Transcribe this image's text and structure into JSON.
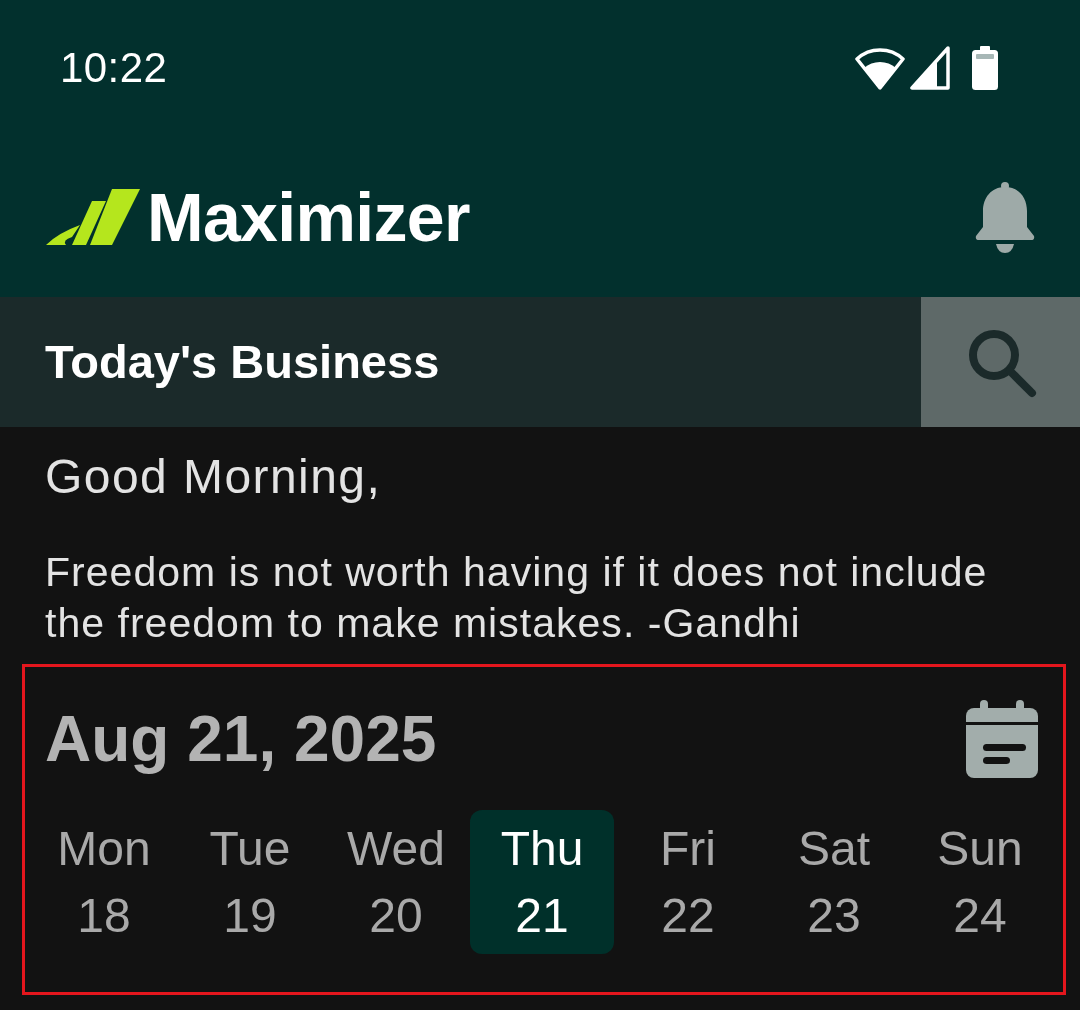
{
  "status_bar": {
    "time": "10:22"
  },
  "app_bar": {
    "logo_text": "Maximizer"
  },
  "title_bar": {
    "title": "Today's Business"
  },
  "greeting": {
    "salutation": "Good Morning,",
    "quote": "Freedom is not worth having if it does not include the freedom to make mistakes. -Gandhi"
  },
  "week": {
    "highlighted": true,
    "date": "Aug 21, 2025",
    "days": [
      {
        "name": "Mon",
        "number": "18",
        "selected": false
      },
      {
        "name": "Tue",
        "number": "19",
        "selected": false
      },
      {
        "name": "Wed",
        "number": "20",
        "selected": false
      },
      {
        "name": "Thu",
        "number": "21",
        "selected": true
      },
      {
        "name": "Fri",
        "number": "22",
        "selected": false
      },
      {
        "name": "Sat",
        "number": "23",
        "selected": false
      },
      {
        "name": "Sun",
        "number": "24",
        "selected": false
      }
    ]
  }
}
